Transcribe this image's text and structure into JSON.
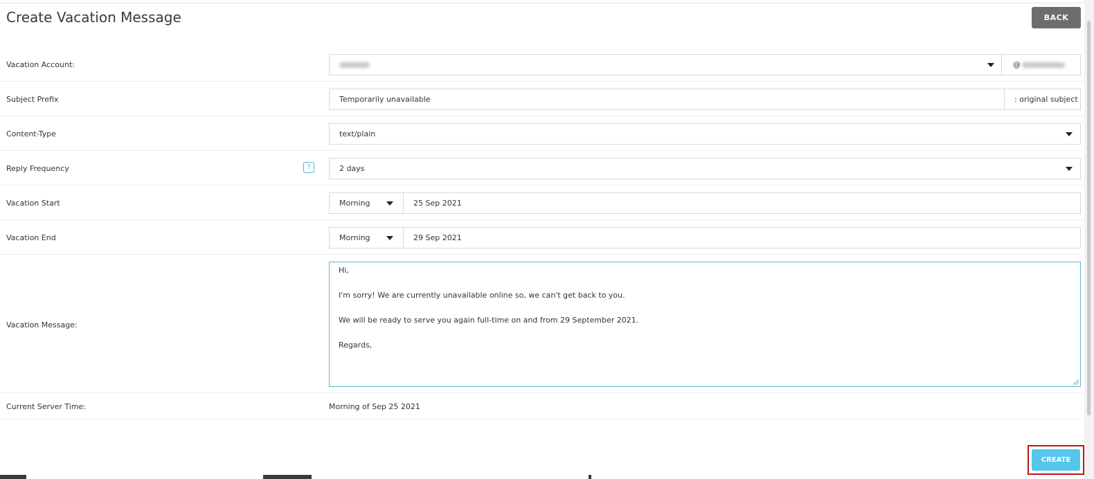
{
  "page": {
    "title": "Create Vacation Message"
  },
  "buttons": {
    "back": "BACK",
    "create": "CREATE"
  },
  "form": {
    "vacation_account": {
      "label": "Vacation Account:",
      "value_redacted": true,
      "domain_prefix": "@"
    },
    "subject_prefix": {
      "label": "Subject Prefix",
      "value": "Temporarily unavailable",
      "suffix": ": original subject"
    },
    "content_type": {
      "label": "Content-Type",
      "value": "text/plain"
    },
    "reply_frequency": {
      "label": "Reply Frequency",
      "help": "?",
      "value": "2 days"
    },
    "vacation_start": {
      "label": "Vacation Start",
      "time_of_day": "Morning",
      "date": "25 Sep 2021"
    },
    "vacation_end": {
      "label": "Vacation End",
      "time_of_day": "Morning",
      "date": "29 Sep 2021"
    },
    "vacation_message": {
      "label": "Vacation Message:",
      "lines": [
        "Hi,",
        "I'm sorry! We are currently unavailable online so, we can't get back to you.",
        "We will be ready to serve you again full-time on and from 29 September 2021.",
        "Regards,"
      ]
    },
    "server_time": {
      "label": "Current Server Time:",
      "value": "Morning of Sep 25 2021"
    }
  },
  "colors": {
    "accent": "#55c7ec",
    "back_button": "#6d6d6d",
    "highlight_frame": "#c0141b",
    "focus_border": "#5fb3cf"
  }
}
